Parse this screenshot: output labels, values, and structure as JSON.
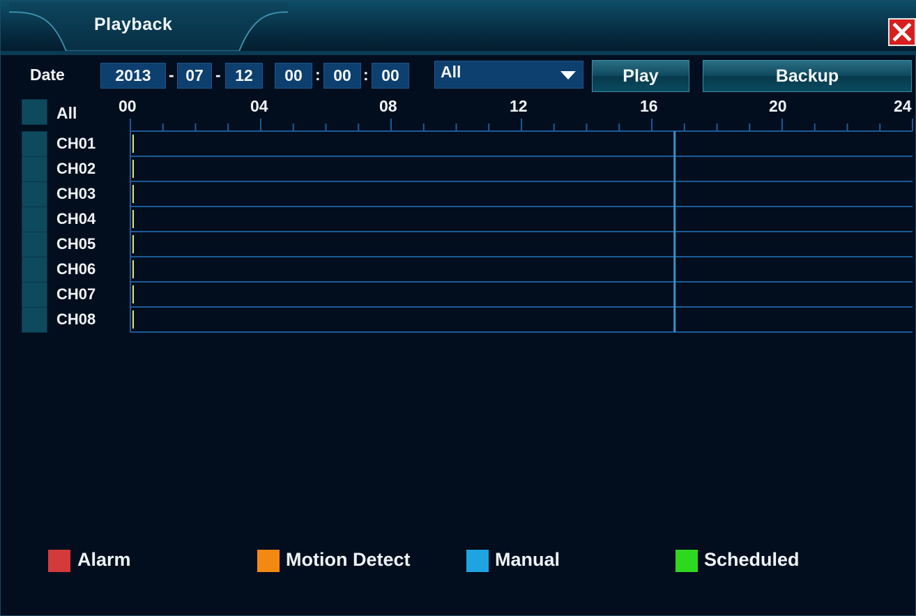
{
  "window": {
    "title": "Playback",
    "close_icon": "close-icon"
  },
  "filter": {
    "date_label": "Date",
    "year": "2013",
    "month": "07",
    "day": "12",
    "hour": "00",
    "minute": "00",
    "second": "00",
    "date_sep": "-",
    "time_sep": ":",
    "record_type": "All",
    "dropdown_icon": "caret-down-icon",
    "play_label": "Play",
    "backup_label": "Backup"
  },
  "timeline": {
    "select_all_label": "All",
    "hours": [
      "00",
      "04",
      "08",
      "12",
      "16",
      "20",
      "24"
    ],
    "current_position_hour": 0,
    "marker_hour": 16.7,
    "channels": [
      "CH01",
      "CH02",
      "CH03",
      "CH04",
      "CH05",
      "CH06",
      "CH07",
      "CH08"
    ]
  },
  "legend": {
    "items": [
      {
        "label": "Alarm",
        "color": "#d43a3a"
      },
      {
        "label": "Motion Detect",
        "color": "#f28a12"
      },
      {
        "label": "Manual",
        "color": "#1ea4e0"
      },
      {
        "label": "Scheduled",
        "color": "#2ed81e"
      }
    ]
  },
  "colors": {
    "background": "#020e1e",
    "field": "#0d3f6f",
    "grid_line": "#1c5a98",
    "cursor": "#e8e870",
    "marker": "#3c92c4",
    "close": "#d81e1e"
  }
}
